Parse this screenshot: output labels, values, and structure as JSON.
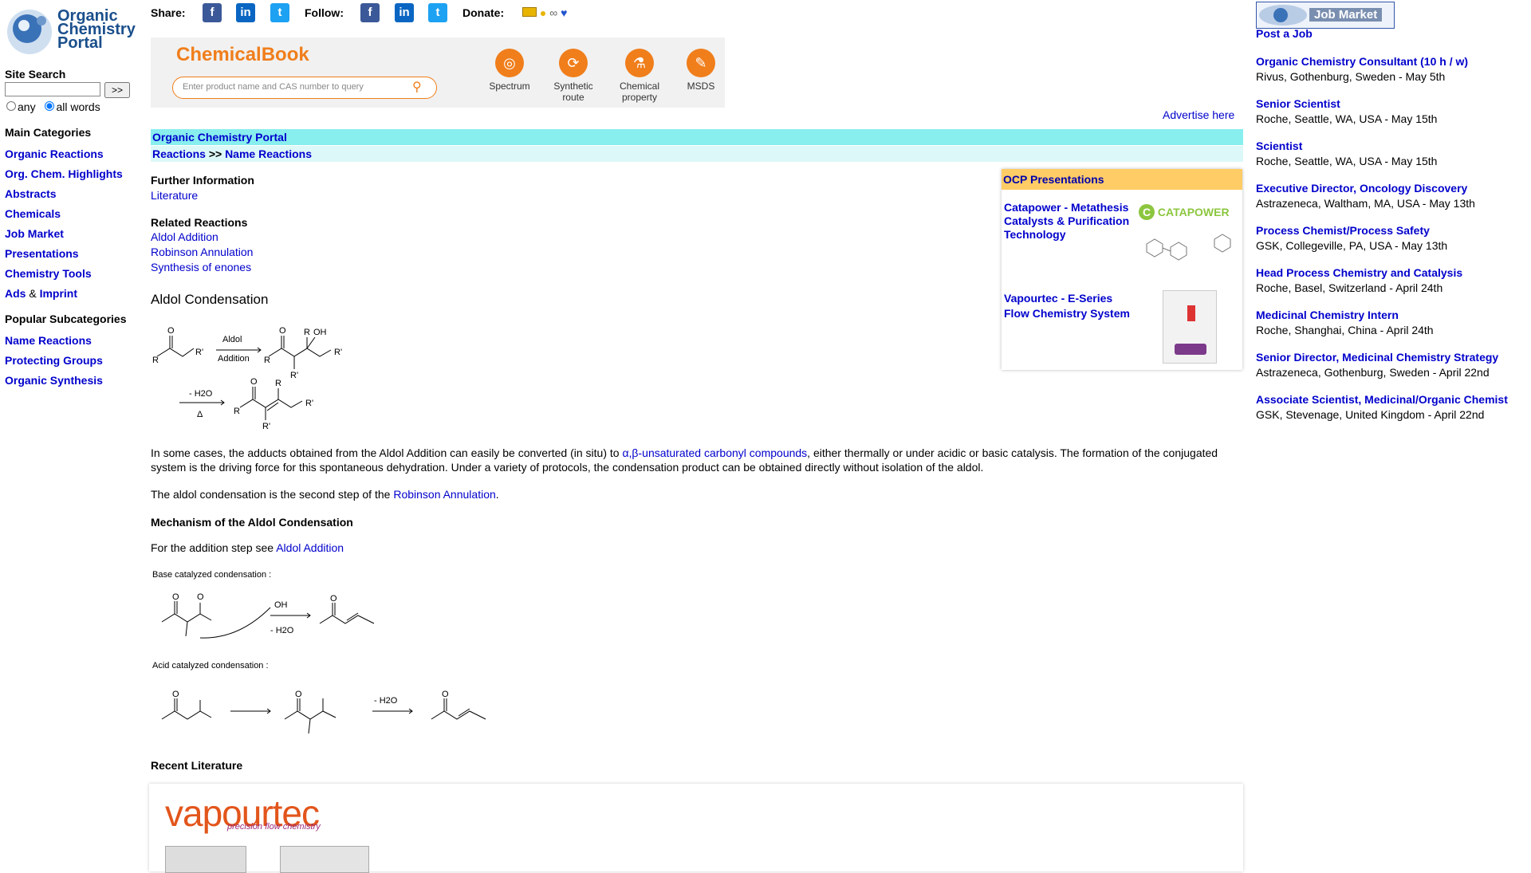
{
  "logo": {
    "line1": "Organic",
    "line2": "Chemistry",
    "line3": "Portal"
  },
  "share_bar": {
    "share_label": "Share:",
    "follow_label": "Follow:",
    "donate_label": "Donate:",
    "icons": [
      "facebook-icon",
      "linkedin-icon",
      "twitter-icon"
    ]
  },
  "site_search": {
    "title": "Site Search",
    "button": ">>",
    "options": [
      "any",
      "all words"
    ],
    "selected": "all words"
  },
  "main_categories": {
    "title": "Main Categories",
    "items": [
      "Organic Reactions",
      "Org. Chem. Highlights",
      "Abstracts",
      "Chemicals",
      "Job Market",
      "Presentations",
      "Chemistry Tools"
    ],
    "ads": "Ads",
    "amp": "&",
    "imprint": "Imprint"
  },
  "popular_subcategories": {
    "title": "Popular Subcategories",
    "items": [
      "Name Reactions",
      "Protecting Groups",
      "Organic Synthesis"
    ]
  },
  "chemicalbook": {
    "title": "ChemicalBook",
    "search_placeholder": "Enter product name and CAS number to query",
    "buttons": [
      {
        "label1": "Spectrum",
        "label2": ""
      },
      {
        "label1": "Synthetic",
        "label2": "route"
      },
      {
        "label1": "Chemical",
        "label2": "property"
      },
      {
        "label1": "MSDS",
        "label2": ""
      }
    ]
  },
  "advertise": "Advertise here",
  "breadcrumb": {
    "portal": "Organic Chemistry Portal",
    "reactions": "Reactions",
    "sep": ">>",
    "name_reactions": "Name Reactions"
  },
  "further_info": {
    "title": "Further Information",
    "literature": "Literature"
  },
  "related": {
    "title": "Related Reactions",
    "items": [
      "Aldol Addition",
      "Robinson Annulation",
      "Synthesis of enones"
    ]
  },
  "page_title": "Aldol Condensation",
  "scheme": {
    "aldol": "Aldol",
    "addition": "Addition",
    "minus_h2o": "- H2O",
    "delta": "Δ",
    "r": "R",
    "r1": "R'",
    "o": "O",
    "oh": "OH"
  },
  "body": {
    "p1_a": "In some cases, the adducts obtained from the Aldol Addition can easily be converted (in situ) to ",
    "p1_link": "α,β-unsaturated carbonyl compounds",
    "p1_b": ", either thermally or under acidic or basic catalysis. The formation of the conjugated system is the driving force for this spontaneous dehydration. Under a variety of protocols, the condensation product can be obtained directly without isolation of the aldol.",
    "p2_a": "The aldol condensation is the second step of the ",
    "p2_link": "Robinson Annulation",
    "p2_b": ".",
    "mech_title": "Mechanism of the Aldol Condensation",
    "p3_a": "For the addition step see ",
    "p3_link": "Aldol Addition",
    "base_label": "Base catalyzed condensation :",
    "acid_label": "Acid catalyzed condensation :",
    "recent": "Recent Literature"
  },
  "ocp": {
    "title": "OCP Presentations",
    "items": [
      {
        "text": "Catapower - Metathesis Catalysts & Purification Technology",
        "brand": "CATAPOWER"
      },
      {
        "text": "Vapourtec - E-Series Flow Chemistry System"
      }
    ]
  },
  "vapourtec": {
    "brand": "vapourtec",
    "tagline": "precision flow chemistry"
  },
  "jobs": {
    "header": "Job Market",
    "post": "Post a Job",
    "items": [
      {
        "title": "Organic Chemistry Consultant (10 h / w)",
        "detail": "Rivus, Gothenburg, Sweden - May 5th"
      },
      {
        "title": "Senior Scientist",
        "detail": "Roche, Seattle, WA, USA - May 15th"
      },
      {
        "title": "Scientist",
        "detail": "Roche, Seattle, WA, USA - May 15th"
      },
      {
        "title": "Executive Director, Oncology Discovery",
        "detail": "Astrazeneca, Waltham, MA, USA - May 13th"
      },
      {
        "title": "Process Chemist/Process Safety",
        "detail": "GSK, Collegeville, PA, USA - May 13th"
      },
      {
        "title": "Head Process Chemistry and Catalysis",
        "detail": "Roche, Basel, Switzerland - April 24th"
      },
      {
        "title": "Medicinal Chemistry Intern",
        "detail": "Roche, Shanghai, China - April 24th"
      },
      {
        "title": "Senior Director, Medicinal Chemistry Strategy",
        "detail": "Astrazeneca, Gothenburg, Sweden - April 22nd"
      },
      {
        "title": "Associate Scientist, Medicinal/Organic Chemist",
        "detail": "GSK, Stevenage, United Kingdom - April 22nd"
      }
    ]
  }
}
